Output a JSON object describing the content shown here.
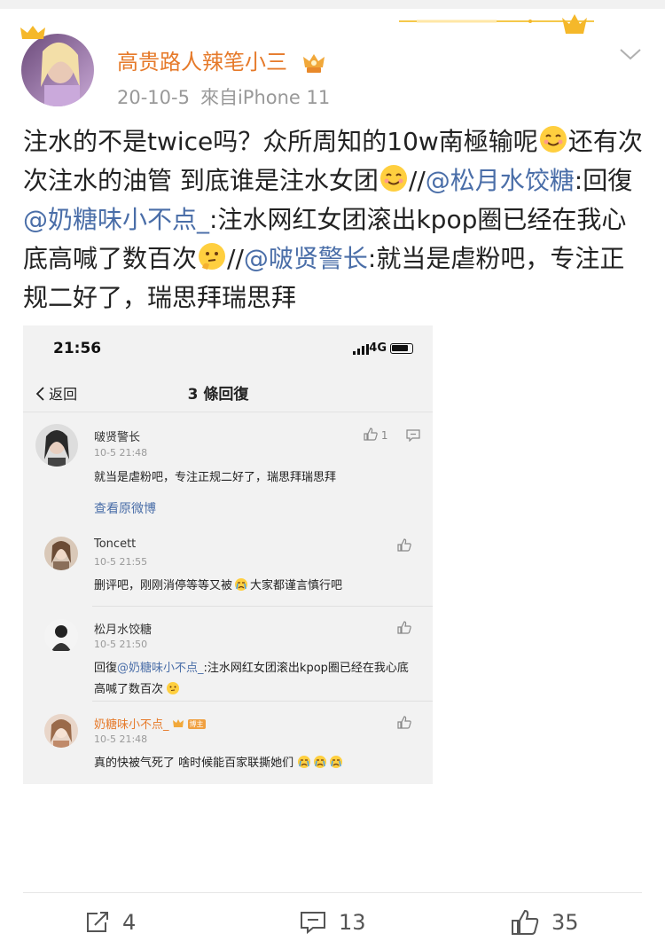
{
  "post": {
    "author": "高贵路人辣笔小三",
    "date": "20-10-5",
    "source": "來自iPhone 11",
    "text": {
      "t1": "注水的不是twice吗？众所周知的10w南極输呢",
      "t2": "还有次次注水的油管 到底谁是注水女团",
      "t3": "//",
      "t4": "@松月水饺糖",
      "t5": ":回復",
      "t6": "@奶糖味小不点_",
      "t7": ":注水网红女团滚出kpop圈已经在我心底高喊了数百次",
      "t8": "//",
      "t9": "@啵贤警长",
      "t10": ":就当是虐粉吧，专注正规二好了，瑞思拜瑞思拜"
    }
  },
  "screenshot": {
    "status_time": "21:56",
    "network": "4G",
    "back_label": "返回",
    "title": "3 條回復",
    "original": {
      "name": "啵贤警长",
      "time": "10-5 21:48",
      "text": "就当是虐粉吧，专注正规二好了，瑞思拜瑞思拜",
      "like_count": "1",
      "link": "查看原微博"
    },
    "replies": [
      {
        "name": "Toncett",
        "time": "10-5 21:55",
        "text_a": "删评吧，刚刚消停等等又被",
        "text_b": "大家都谨言慎行吧"
      },
      {
        "name": "松月水饺糖",
        "time": "10-5 21:50",
        "prefix": "回復",
        "mention": "@奶糖味小不点_",
        "text_b": ":注水网红女团滚出kpop圈已经在我心底高喊了数百次"
      },
      {
        "name": "奶糖味小不点_",
        "tag": "博主",
        "time": "10-5 21:48",
        "text_a": "真的快被气死了 啥时候能百家联撕她们"
      }
    ]
  },
  "actions": {
    "repost_count": "4",
    "comment_count": "13",
    "like_count": "35"
  },
  "colors": {
    "username": "#e67a2a",
    "mention": "#4a6ea8",
    "meta": "#999999"
  },
  "icons": [
    "crown-icon",
    "vip-crown-badge-icon",
    "chevron-down-icon",
    "smile-emoji-icon",
    "think-emoji-icon",
    "cry-emoji-icon",
    "signal-icon",
    "battery-icon",
    "back-chevron-icon",
    "thumb-up-icon",
    "comment-icon",
    "repost-icon"
  ]
}
